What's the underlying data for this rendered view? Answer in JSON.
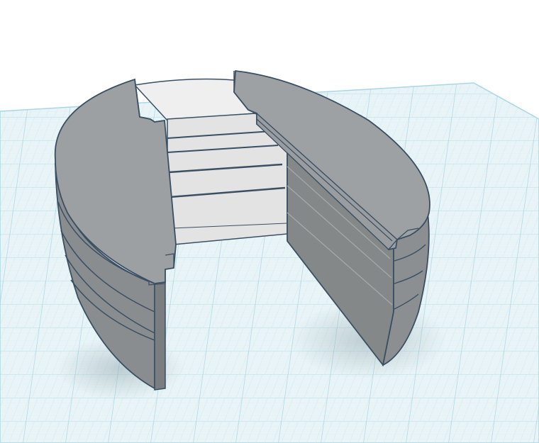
{
  "app": {
    "view": "3d-workplane-viewport"
  },
  "workplane": {
    "grid_visible": true,
    "grid_color": "#a9d6e2",
    "plane_color": "#e6f2f6",
    "background_color": "#ffffff"
  },
  "model": {
    "body_color": "#8e9194",
    "top_face_color": "#9ea1a4",
    "inner_wall_color": "#e3e3e3",
    "edge_color": "#3a4f63"
  }
}
